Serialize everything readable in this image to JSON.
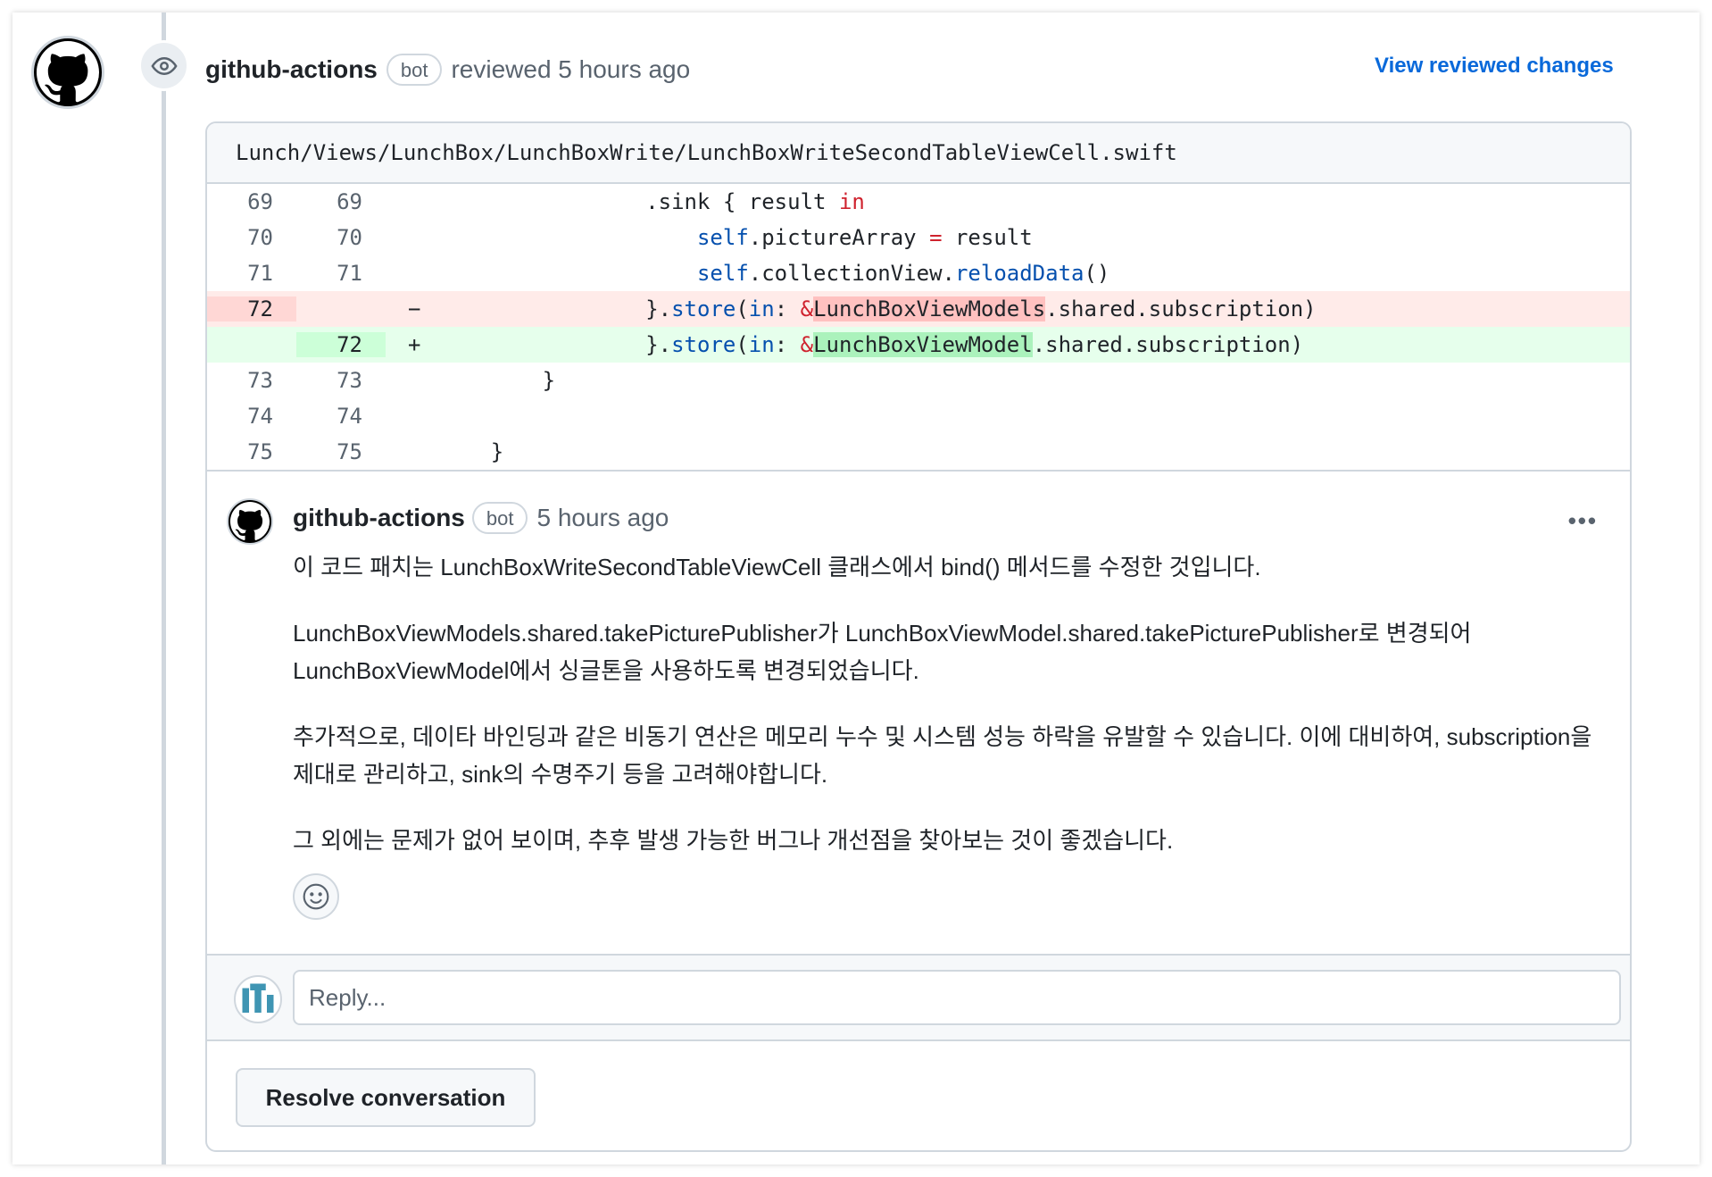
{
  "review": {
    "author": "github-actions",
    "bot_label": "bot",
    "meta": "reviewed 5 hours ago",
    "view_changes_label": "View reviewed changes"
  },
  "file": {
    "path": "Lunch/Views/LunchBox/LunchBoxWrite/LunchBoxWriteSecondTableViewCell.swift"
  },
  "diff": {
    "rows": [
      {
        "old": "69",
        "new": "69",
        "marker": "",
        "type": "context"
      },
      {
        "old": "70",
        "new": "70",
        "marker": "",
        "type": "context"
      },
      {
        "old": "71",
        "new": "71",
        "marker": "",
        "type": "context"
      },
      {
        "old": "72",
        "new": "",
        "marker": "−",
        "type": "del"
      },
      {
        "old": "",
        "new": "72",
        "marker": "+",
        "type": "add"
      },
      {
        "old": "73",
        "new": "73",
        "marker": "",
        "type": "context"
      },
      {
        "old": "74",
        "new": "74",
        "marker": "",
        "type": "context"
      },
      {
        "old": "75",
        "new": "75",
        "marker": "",
        "type": "context"
      }
    ],
    "code": {
      "r69_indent": "                .sink { result ",
      "r69_kw": "in",
      "r70_indent": "                    ",
      "r70_self": "self",
      "r70_rest": ".pictureArray ",
      "r70_eq": "=",
      "r70_tail": " result",
      "r71_indent": "                    ",
      "r71_self": "self",
      "r71_mid": ".collectionView.",
      "r71_fn": "reloadData",
      "r71_tail": "()",
      "r72d_indent": "                }.",
      "r72d_store": "store",
      "r72d_paren": "(",
      "r72d_in": "in",
      "r72d_colon": ": ",
      "r72d_amp": "&",
      "r72d_hl": "LunchBoxViewModels",
      "r72d_tail": ".shared.subscription)",
      "r72a_indent": "                }.",
      "r72a_store": "store",
      "r72a_paren": "(",
      "r72a_in": "in",
      "r72a_colon": ": ",
      "r72a_amp": "&",
      "r72a_hl": "LunchBoxViewModel",
      "r72a_tail": ".shared.subscription)",
      "r73": "        }",
      "r74": "",
      "r75": "    }"
    }
  },
  "comment": {
    "author": "github-actions",
    "bot_label": "bot",
    "time": "5 hours ago",
    "more_label": "•••",
    "paragraphs": [
      "이 코드 패치는 LunchBoxWriteSecondTableViewCell 클래스에서 bind() 메서드를 수정한 것입니다.",
      "LunchBoxViewModels.shared.takePicturePublisher가 LunchBoxViewModel.shared.takePicturePublisher로 변경되어 LunchBoxViewModel에서 싱글톤을 사용하도록 변경되었습니다.",
      "추가적으로, 데이타 바인딩과 같은 비동기 연산은 메모리 누수 및 시스템 성능 하락을 유발할 수 있습니다. 이에 대비하여, subscription을 제대로 관리하고, sink의 수명주기 등을 고려해야합니다.",
      "그 외에는 문제가 없어 보이며, 추후 발생 가능한 버그나 개선점을 찾아보는 것이 좋겠습니다."
    ]
  },
  "reply": {
    "placeholder": "Reply..."
  },
  "resolve_label": "Resolve conversation",
  "colors": {
    "link": "#0969da",
    "del_bg": "#ffebe9",
    "add_bg": "#e6ffec",
    "border": "#d0d7de"
  }
}
